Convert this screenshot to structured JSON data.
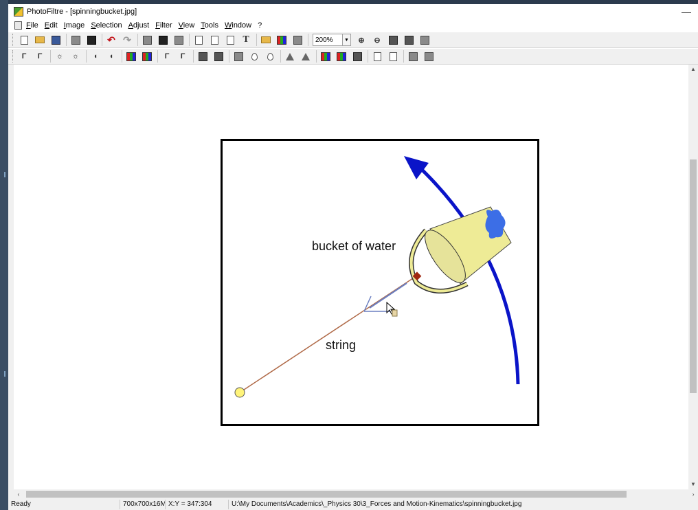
{
  "window": {
    "title": "PhotoFiltre - [spinningbucket.jpg]"
  },
  "menu": [
    "File",
    "Edit",
    "Image",
    "Selection",
    "Adjust",
    "Filter",
    "View",
    "Tools",
    "Window",
    "?"
  ],
  "toolbar": {
    "zoom_value": "200%"
  },
  "canvas": {
    "bucket_label": "bucket of water",
    "string_label": "string",
    "colors": {
      "arrow": "#0a14c8",
      "bucket": "#eeeb96",
      "water": "#3c6ee6",
      "string": "#b06a48",
      "force_arrow": "#6a7ec0",
      "pivot": "#fff47a"
    }
  },
  "status": {
    "state": "Ready",
    "image_info": "700x700x16M",
    "coords": "X:Y = 347:304",
    "path": "U:\\My Documents\\Academics\\_Physics 30\\3_Forces and Motion-Kinematics\\spinningbucket.jpg"
  },
  "icons": [
    "close-icon",
    "new-file-icon",
    "open-folder-icon",
    "save-icon",
    "print-icon",
    "undo-icon",
    "redo-icon",
    "zoom-in-icon",
    "zoom-out-icon",
    "text-tool-icon"
  ]
}
